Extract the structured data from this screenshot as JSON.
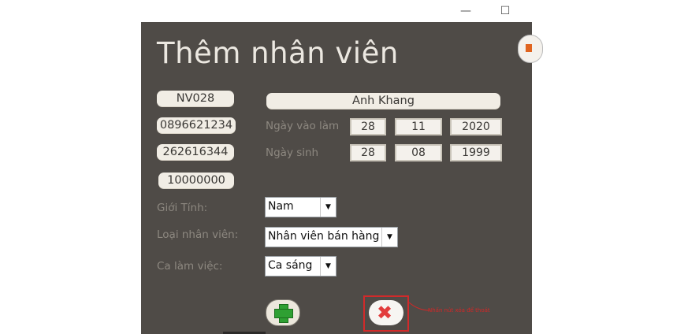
{
  "window": {
    "minimize": "—",
    "maximize": "☐"
  },
  "form": {
    "title": "Thêm nhân viên",
    "employee_id": "NV028",
    "phone": "0896621234",
    "id_number": "262616344",
    "salary": "10000000",
    "name": "Anh Khang",
    "start_date": {
      "label": "Ngày vào làm",
      "day": "28",
      "month": "11",
      "year": "2020"
    },
    "birth_date": {
      "label": "Ngày sinh",
      "day": "28",
      "month": "08",
      "year": "1999"
    },
    "gender": {
      "label": "Giới Tính:",
      "value": "Nam"
    },
    "employee_type": {
      "label": "Loại nhân viên:",
      "value": "Nhân viên bán hàng"
    },
    "shift": {
      "label": "Ca làm việc:",
      "value": "Ca sáng"
    },
    "add_icon": "plus-icon",
    "close_icon": "close-icon"
  },
  "annotation": {
    "text": "Nhấn nút xóa để thoát",
    "color": "#d42727"
  },
  "colors": {
    "background": "#4f4b47",
    "accent": "#2fa033",
    "danger": "#e23c3c"
  }
}
